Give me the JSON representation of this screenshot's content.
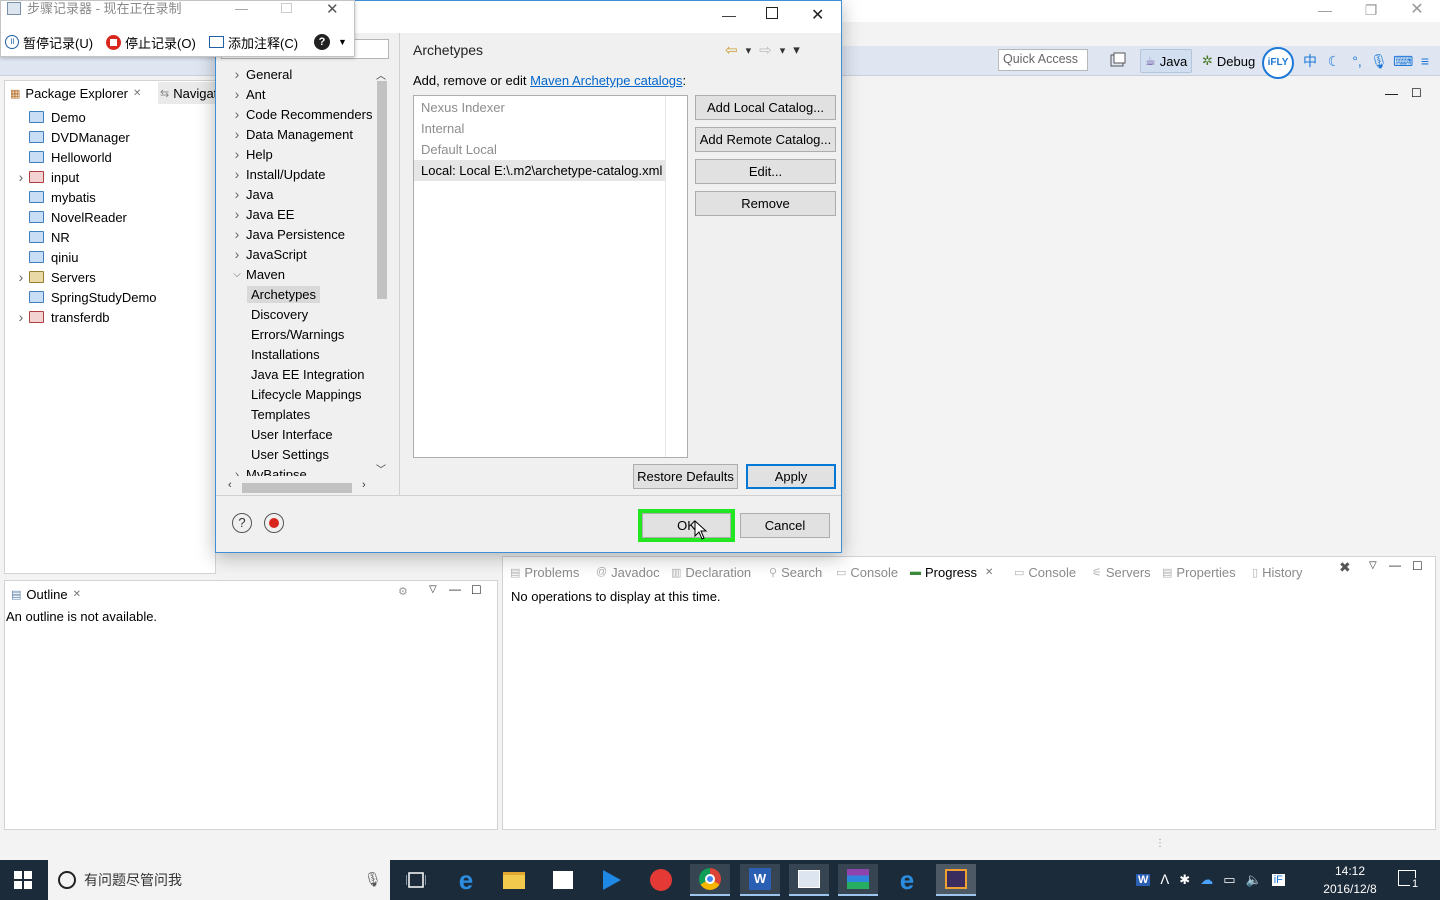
{
  "psr": {
    "title": "步骤记录器 - 现在正在录制",
    "pause": "暂停记录(U)",
    "stop": "停止记录(O)",
    "add_comment": "添加注释(C)"
  },
  "eclipse": {
    "quick_access": "Quick Access",
    "perspectives": {
      "java": "Java",
      "debug": "Debug"
    },
    "package_explorer": {
      "tab": "Package Explorer",
      "nav_tab": "Navigator",
      "items": [
        {
          "label": "Demo",
          "expandable": false,
          "type": "folder"
        },
        {
          "label": "DVDManager",
          "expandable": false,
          "type": "folder"
        },
        {
          "label": "Helloworld",
          "expandable": false,
          "type": "folder"
        },
        {
          "label": "input",
          "expandable": true,
          "type": "db"
        },
        {
          "label": "mybatis",
          "expandable": false,
          "type": "folder"
        },
        {
          "label": "NovelReader",
          "expandable": false,
          "type": "folder"
        },
        {
          "label": "NR",
          "expandable": false,
          "type": "folder"
        },
        {
          "label": "qiniu",
          "expandable": false,
          "type": "folder"
        },
        {
          "label": "Servers",
          "expandable": true,
          "type": "folder-open"
        },
        {
          "label": "SpringStudyDemo",
          "expandable": false,
          "type": "folder"
        },
        {
          "label": "transferdb",
          "expandable": true,
          "type": "db"
        }
      ]
    },
    "outline": {
      "tab": "Outline",
      "empty": "An outline is not available."
    },
    "bottom_tabs": [
      "Problems",
      "Javadoc",
      "Declaration",
      "Search",
      "Console",
      "Progress",
      "Console",
      "Servers",
      "Properties",
      "History"
    ],
    "progress_empty": "No operations to display at this time."
  },
  "dialog": {
    "tree": [
      {
        "label": "General",
        "level": 0,
        "state": "collapsed"
      },
      {
        "label": "Ant",
        "level": 0,
        "state": "collapsed"
      },
      {
        "label": "Code Recommenders",
        "level": 0,
        "state": "collapsed"
      },
      {
        "label": "Data Management",
        "level": 0,
        "state": "collapsed"
      },
      {
        "label": "Help",
        "level": 0,
        "state": "collapsed"
      },
      {
        "label": "Install/Update",
        "level": 0,
        "state": "collapsed"
      },
      {
        "label": "Java",
        "level": 0,
        "state": "collapsed"
      },
      {
        "label": "Java EE",
        "level": 0,
        "state": "collapsed"
      },
      {
        "label": "Java Persistence",
        "level": 0,
        "state": "collapsed"
      },
      {
        "label": "JavaScript",
        "level": 0,
        "state": "collapsed"
      },
      {
        "label": "Maven",
        "level": 0,
        "state": "expanded"
      },
      {
        "label": "Archetypes",
        "level": 1,
        "state": "selected"
      },
      {
        "label": "Discovery",
        "level": 1,
        "state": "leaf"
      },
      {
        "label": "Errors/Warnings",
        "level": 1,
        "state": "leaf"
      },
      {
        "label": "Installations",
        "level": 1,
        "state": "leaf"
      },
      {
        "label": "Java EE Integration",
        "level": 1,
        "state": "leaf"
      },
      {
        "label": "Lifecycle Mappings",
        "level": 1,
        "state": "leaf"
      },
      {
        "label": "Templates",
        "level": 1,
        "state": "leaf"
      },
      {
        "label": "User Interface",
        "level": 1,
        "state": "leaf"
      },
      {
        "label": "User Settings",
        "level": 1,
        "state": "leaf"
      },
      {
        "label": "MyBatipse",
        "level": 0,
        "state": "collapsed"
      }
    ],
    "page_title": "Archetypes",
    "desc_prefix": "Add, remove or edit ",
    "desc_link": "Maven Archetype catalogs",
    "desc_suffix": ":",
    "catalogs": [
      {
        "label": "Nexus Indexer",
        "selected": false
      },
      {
        "label": "Internal",
        "selected": false
      },
      {
        "label": "Default Local",
        "selected": false
      },
      {
        "label": "Local: Local E:\\.m2\\archetype-catalog.xml",
        "selected": true
      }
    ],
    "buttons": {
      "add_local": "Add Local Catalog...",
      "add_remote": "Add Remote Catalog...",
      "edit": "Edit...",
      "remove": "Remove",
      "restore_defaults": "Restore Defaults",
      "apply": "Apply",
      "ok": "OK",
      "cancel": "Cancel"
    }
  },
  "taskbar": {
    "search_placeholder": "有问题尽管问我",
    "time": "14:12",
    "date": "2016/12/8",
    "notification_count": "1"
  },
  "colors": {
    "ok_highlight": "#22e622",
    "accent": "#0078d7",
    "taskbar": "#1c2b3a"
  }
}
